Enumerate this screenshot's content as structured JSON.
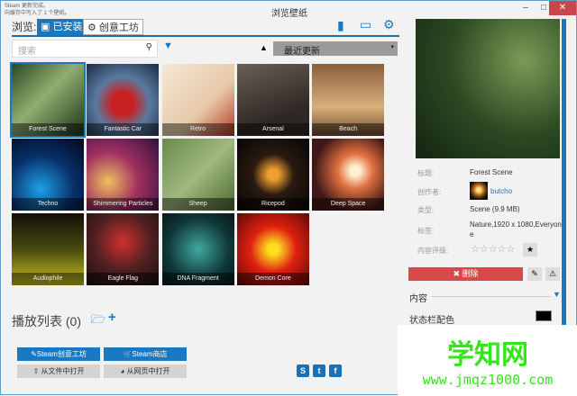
{
  "notification": {
    "line1": "Steam 更新完成。",
    "line2": "向缓存中写入了 1 个壁纸。"
  },
  "window": {
    "title": "浏览壁纸",
    "minimize": "–",
    "maximize": "□",
    "close": "✕"
  },
  "nav": {
    "browse_label": "浏览:",
    "tabs": [
      {
        "label": "已安装",
        "icon": "floppy-icon"
      },
      {
        "label": "创意工坊",
        "icon": "steam-icon"
      }
    ]
  },
  "toolbar": {
    "search_placeholder": "搜索",
    "sort_value": "最近更新"
  },
  "wallpapers": [
    {
      "name": "Forest Scene",
      "bg": "linear-gradient(135deg,#2c4a24,#8fae70 45%,#1d3318)"
    },
    {
      "name": "Fantastic Car",
      "bg": "radial-gradient(circle at 50% 55%,#c92020 20%,#5a7aa0 50%,#1b2a44)"
    },
    {
      "name": "Retro",
      "bg": "linear-gradient(135deg,#f4e9d8,#e7c9a8 60%,#b23a1f)"
    },
    {
      "name": "Arsenal",
      "bg": "linear-gradient(160deg,#6b5f55,#2e2824 70%)"
    },
    {
      "name": "Beach",
      "bg": "linear-gradient(180deg,#8a5f3c,#d7b07a 60%,#6c4a2c)"
    },
    {
      "name": "Techno",
      "bg": "radial-gradient(circle at 40% 70%,#1ea0e8,#08306a 50%,#020818)"
    },
    {
      "name": "Shimmering Particles",
      "bg": "radial-gradient(circle at 30% 60%,#f0c060,#a03060 45%,#301040)"
    },
    {
      "name": "Sheep",
      "bg": "linear-gradient(135deg,#6a8a4a,#a0b880 50%,#4a6a30)"
    },
    {
      "name": "Ricepod",
      "bg": "radial-gradient(circle at 50% 50%,#f0a030 10%,#2a1a10 40%,#050505)"
    },
    {
      "name": "Deep Space",
      "bg": "radial-gradient(circle at 60% 45%,#fff0d0 8%,#e07040 30%,#401818 70%)"
    },
    {
      "name": "Audiophile",
      "bg": "linear-gradient(0deg,#c8c020,#4a4a10 50%,#101008)"
    },
    {
      "name": "Eagle Flag",
      "bg": "radial-gradient(circle at 50% 40%,#d03030,#502020 50%,#1a1010)"
    },
    {
      "name": "DNA Fragment",
      "bg": "radial-gradient(circle at 50% 50%,#40a8a0,#103838 60%,#051818)"
    },
    {
      "name": "Demon Core",
      "bg": "radial-gradient(circle at 50% 50%,#ffe020 10%,#e02010 45%,#600808)"
    }
  ],
  "details": {
    "title_label": "标题:",
    "title": "Forest Scene",
    "author_label": "创作者:",
    "author": "butcho",
    "type_label": "类型:",
    "type": "Scene (9.9 MB)",
    "tags_label": "标签:",
    "tags": "Nature,1920 x 1080,Everyone",
    "rating_label": "内容评级:",
    "stars": "☆☆☆☆☆",
    "delete": "删除",
    "content_label": "内容",
    "statusbar_color_label": "状态栏配色"
  },
  "playlist": {
    "label": "播放列表 (0)"
  },
  "buttons": {
    "workshop": "Steam创意工坊",
    "store": "Steam商店",
    "open_file": "从文件中打开",
    "open_web": "从网页中打开"
  },
  "watermark": {
    "name": "学知网",
    "url": "www.jmqz1000.com"
  },
  "colors": {
    "accent": "#1a78c2",
    "danger": "#d9494b"
  }
}
